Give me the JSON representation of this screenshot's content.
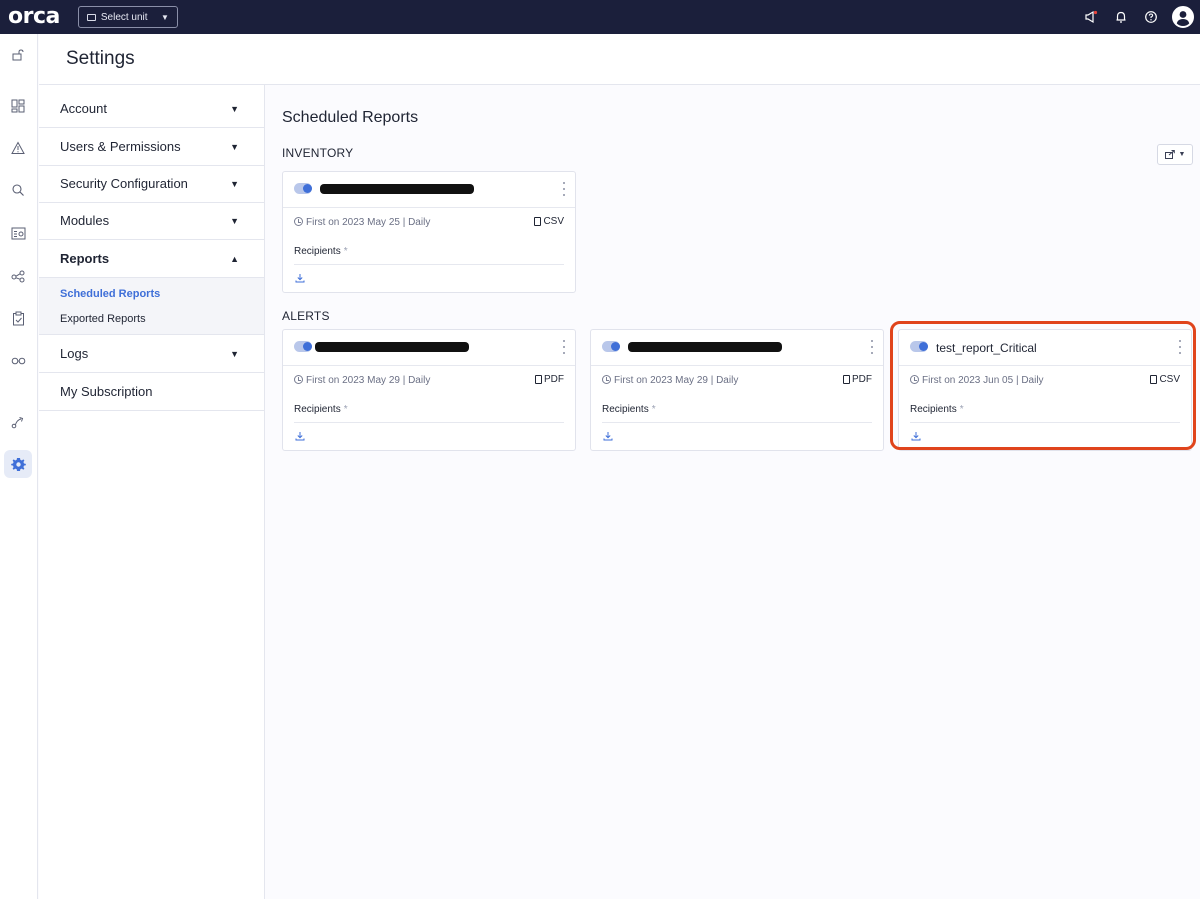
{
  "topbar": {
    "logo": "orca",
    "unit_select_label": "Select unit",
    "icons": [
      "megaphone-icon",
      "bell-icon",
      "help-icon",
      "user-avatar-icon"
    ]
  },
  "rail": {
    "icons": [
      "lock-open-icon",
      "dashboard-icon",
      "alert-icon",
      "search-icon",
      "inventory-icon",
      "graph-icon",
      "compliance-icon",
      "vulnerabilities-icon",
      "integrations-icon",
      "settings-gear-icon"
    ]
  },
  "header": {
    "title": "Settings"
  },
  "sidebar": {
    "items": [
      {
        "label": "Account",
        "caret": "▼"
      },
      {
        "label": "Users & Permissions",
        "caret": "▼"
      },
      {
        "label": "Security Configuration",
        "caret": "▼"
      },
      {
        "label": "Modules",
        "caret": "▼"
      },
      {
        "label": "Reports",
        "caret": "▲"
      },
      {
        "label": "Logs",
        "caret": "▼"
      },
      {
        "label": "My Subscription",
        "caret": ""
      }
    ],
    "reports_sub": [
      {
        "label": "Scheduled Reports",
        "active": true
      },
      {
        "label": "Exported Reports",
        "active": false
      }
    ]
  },
  "main": {
    "title": "Scheduled Reports",
    "sections": [
      {
        "label": "INVENTORY",
        "cards": [
          {
            "name": "",
            "redacted": true,
            "schedule": "First on 2023 May 25 | Daily",
            "format": "CSV",
            "recipients_label": "Recipients",
            "required_mark": "*"
          }
        ]
      },
      {
        "label": "ALERTS",
        "cards": [
          {
            "name": "",
            "redacted": true,
            "schedule": "First on 2023 May 29 | Daily",
            "format": "PDF",
            "recipients_label": "Recipients",
            "required_mark": "*"
          },
          {
            "name": "",
            "redacted": true,
            "schedule": "First on 2023 May 29 | Daily",
            "format": "PDF",
            "recipients_label": "Recipients",
            "required_mark": "*"
          },
          {
            "name": "test_report_Critical",
            "redacted": false,
            "schedule": "First on 2023 Jun 05 | Daily",
            "format": "CSV",
            "recipients_label": "Recipients",
            "required_mark": "*"
          }
        ]
      }
    ],
    "export_button_caret": "▼"
  },
  "colors": {
    "topbar_bg": "#1b1f3b",
    "accent_blue": "#3f6fd8",
    "highlight_annotation": "#e0441c"
  }
}
